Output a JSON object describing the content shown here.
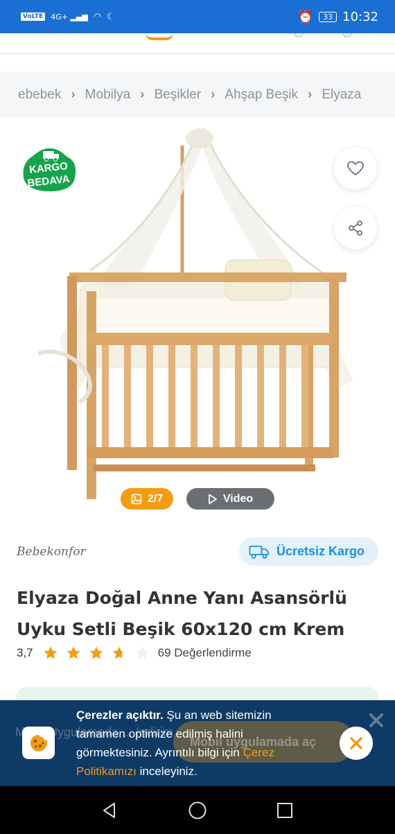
{
  "status_bar": {
    "network_tag": "VoLTE",
    "signal_label": "4G+",
    "battery": "33",
    "time": "10:32"
  },
  "breadcrumb": [
    "ebebek",
    "Mobilya",
    "Beşikler",
    "Ahşap Beşik",
    "Elyaza"
  ],
  "gallery": {
    "badge_line1": "KARGO",
    "badge_line2": "BEDAVA",
    "photo_counter": "2/7",
    "video_label": "Video"
  },
  "product": {
    "brand": "Bebekonfor",
    "shipping_chip": "Ücretsiz Kargo",
    "title": "Elyaza Doğal Anne Yanı Asansörlü Uyku Setli Beşik 60x120 cm Krem",
    "rating": "3,7",
    "rating_value": 3.7,
    "rating_max": 5,
    "reviews": "69 Değerlendirme"
  },
  "cookie_banner": {
    "background_hint_text": "Mobil Uygulamada ... İndirim",
    "background_hint_button": "Mobil uygulamada aç",
    "strong": "Çerezler açıktır.",
    "text_1": " Şu an web sitemizin tamamen optimize edilmiş halini görmektesiniz. Ayrıntılı bilgi için ",
    "link": "Çerez Politikamızı",
    "text_2": " inceleyiniz."
  },
  "colors": {
    "status_bar": "#1a6fd4",
    "accent_orange": "#f39c12",
    "kargo_green": "#16a34a",
    "cookie_bg": "#0e3a66",
    "chip_bg": "#e3f1fb",
    "chip_text": "#1c8fe0"
  },
  "icons": {
    "favorite": "heart-icon",
    "share": "share-icon",
    "photos": "image-icon",
    "video": "play-icon",
    "cargo": "truck-icon",
    "cookie": "cookie-icon",
    "close": "close-icon"
  }
}
